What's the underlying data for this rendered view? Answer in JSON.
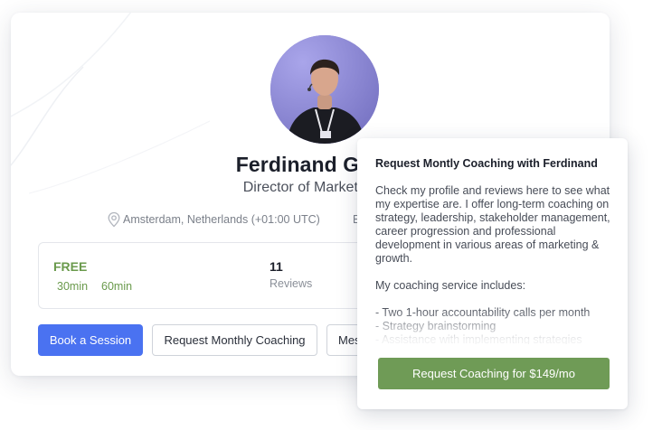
{
  "profile": {
    "name": "Ferdinand Goss",
    "title": "Director of Marketing",
    "location": "Amsterdam, Netherlands (+01:00 UTC)",
    "location_extra": "E"
  },
  "stats": {
    "price_label": "FREE",
    "durations": [
      "30min",
      "60min"
    ],
    "reviews_count": "11",
    "reviews_label": "Reviews"
  },
  "actions": {
    "book": "Book a Session",
    "monthly": "Request Monthly Coaching",
    "message": "Mes"
  },
  "popover": {
    "title": "Request Montly Coaching with Ferdinand",
    "body": [
      "Check my profile and reviews here to see what my expertise are. I offer long-term coaching on strategy, leadership, stakeholder management, career progression and professional development in various areas of marketing & growth.",
      "",
      "My coaching service includes:",
      "",
      "- Two 1-hour accountability calls per month",
      "- Strategy brainstorming",
      "- Assistance with implementing strategies"
    ],
    "cta": "Request  Coaching for $149/mo"
  },
  "colors": {
    "primary": "#4a72f1",
    "accent_green": "#6a9a4c",
    "cta_green": "#6f9b56"
  },
  "icons": {
    "location": "map-pin-icon"
  }
}
